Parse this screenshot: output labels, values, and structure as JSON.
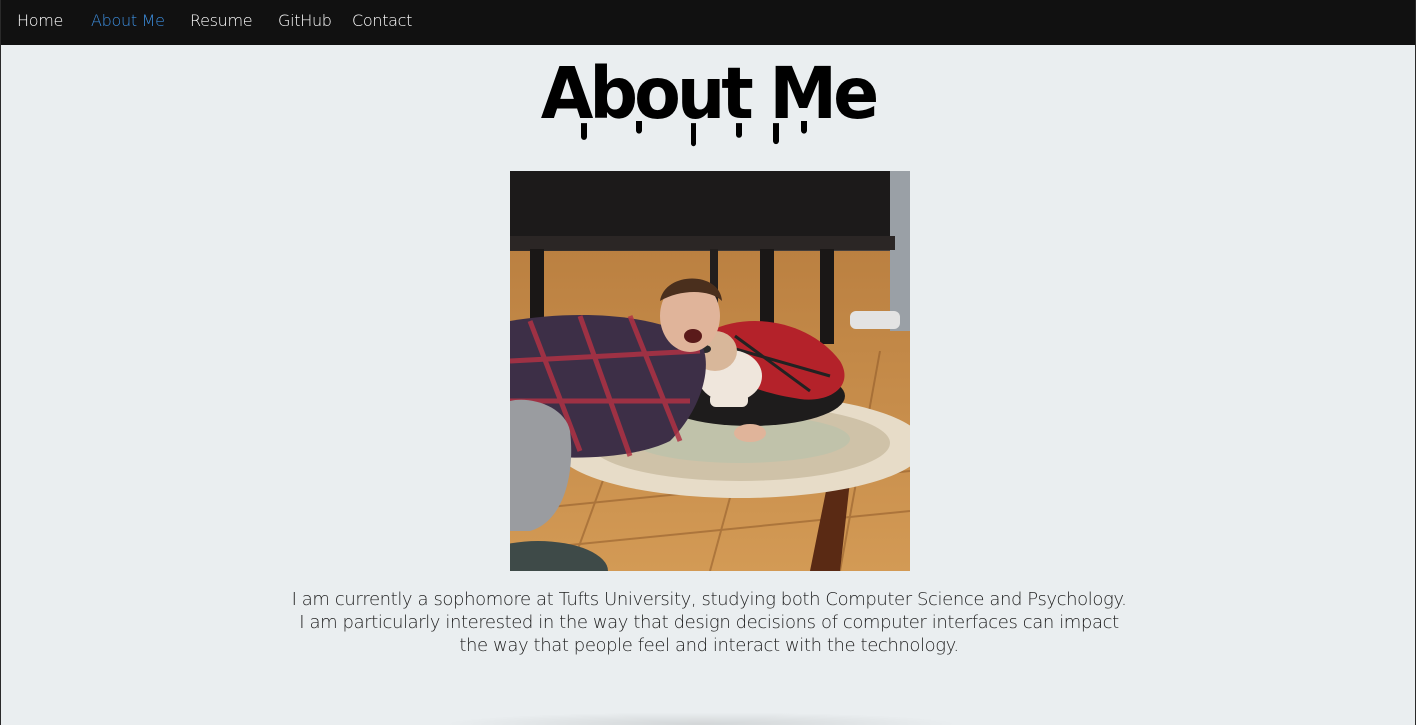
{
  "nav": {
    "items": [
      {
        "label": "Home",
        "active": false
      },
      {
        "label": "About Me",
        "active": true
      },
      {
        "label": "Resume",
        "active": false
      },
      {
        "label": "GitHub",
        "active": false
      },
      {
        "label": "Contact",
        "active": false
      }
    ]
  },
  "page": {
    "title": "About Me",
    "bio_lines": [
      "I am currently a sophomore at Tufts University, studying both Computer Science and Psychology.",
      "I am particularly interested in the way that design decisions of computer interfaces can impact",
      "the way that people feel and interact with the technology."
    ]
  },
  "colors": {
    "navbar_bg": "#111111",
    "nav_text": "#ffffff",
    "nav_active": "#3d8fe0",
    "page_bg": "#eaeef0"
  }
}
